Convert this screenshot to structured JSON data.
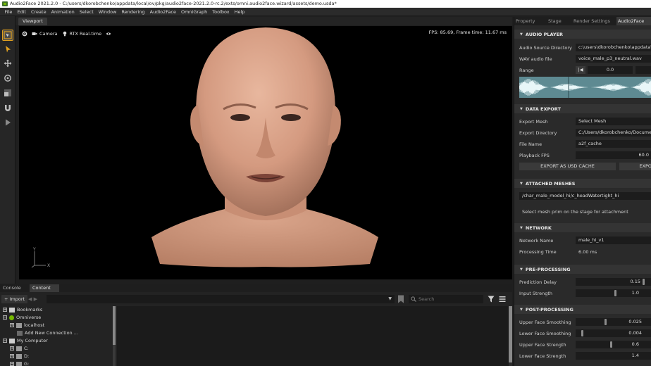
{
  "window": {
    "title": "Audio2Face 2021.2.0 - C:/users/dkorobchenko/appdata/local/ov/pkg/audio2face-2021.2.0-rc.2/exts/omni.audio2face.wizard/assets/demo.usda*"
  },
  "menu": [
    "File",
    "Edit",
    "Create",
    "Animation",
    "Select",
    "Window",
    "Rendering",
    "Audio2Face",
    "OmniGraph",
    "Toolbox",
    "Help"
  ],
  "toolbar": {
    "tools": [
      "select-mode-icon",
      "arrow-select-icon",
      "move-icon",
      "rotate-icon",
      "scale-icon",
      "snap-magnet-icon",
      "play-icon"
    ]
  },
  "viewport": {
    "tab_label": "Viewport",
    "camera_label": "Camera",
    "render_label": "RTX Real-time",
    "fps_text": "FPS: 85.69, Frame time: 11.67 ms",
    "axis_y": "Y",
    "axis_x": "X"
  },
  "right_panel": {
    "tabs": [
      "Property",
      "Stage",
      "Render Settings",
      "Audio2Face"
    ],
    "active_tab": "Audio2Face",
    "audio_player": {
      "header": "AUDIO PLAYER",
      "source_dir_label": "Audio Source Directory",
      "source_dir_value": "c:\\users\\dkorobchenko\\appdata\\lo",
      "wav_label": "WAV audio file",
      "wav_value": "voice_male_p3_neutral.wav",
      "range_label": "Range",
      "range_start": "0.0"
    },
    "data_export": {
      "header": "DATA EXPORT",
      "export_mesh_label": "Export Mesh",
      "export_mesh_value": "Select Mesh",
      "export_dir_label": "Export Directory",
      "export_dir_value": "C:/Users/dkorobchenko/Documents",
      "file_name_label": "File Name",
      "file_name_value": "a2f_cache",
      "fps_label": "Playback FPS",
      "fps_value": "60.0",
      "export_usd_button": "EXPORT AS USD CACHE",
      "export_other_button": "EXPO"
    },
    "attached_meshes": {
      "header": "ATTACHED MESHES",
      "mesh_path": "/char_male_model_hi/c_headWatertight_hi",
      "hint": "Select mesh prim on the stage for attachment"
    },
    "network": {
      "header": "NETWORK",
      "name_label": "Network Name",
      "name_value": "male_hi_v1",
      "time_label": "Processing Time",
      "time_value": "6.00 ms"
    },
    "pre_processing": {
      "header": "PRE-PROCESSING",
      "prediction_delay_label": "Prediction Delay",
      "prediction_delay_value": "0.15",
      "input_strength_label": "Input Strength",
      "input_strength_value": "1.0"
    },
    "post_processing": {
      "header": "POST-PROCESSING",
      "upper_smoothing_label": "Upper Face Smoothing",
      "upper_smoothing_value": "0.025",
      "lower_smoothing_label": "Lower Face Smoothing",
      "lower_smoothing_value": "0.004",
      "upper_strength_label": "Upper Face Strength",
      "upper_strength_value": "0.6",
      "lower_strength_label": "Lower Face Strength",
      "lower_strength_value": "1.4"
    }
  },
  "bottom_panel": {
    "tabs": [
      "Console",
      "Content"
    ],
    "active_tab": "Content",
    "import_label": "+ Import",
    "search_placeholder": "Search",
    "tree": {
      "bookmarks": "Bookmarks",
      "omniverse": "Omniverse",
      "localhost": "localhost",
      "add_connection": "Add New Connection ...",
      "my_computer": "My Computer",
      "drive_c": "C:",
      "drive_d": "D:",
      "drive_g": "G:"
    }
  },
  "colors": {
    "accent": "#76b900",
    "active_tool_border": "#e0a020",
    "waveform": "#e8f6f8",
    "waveform_bg": "#5e8a92"
  }
}
